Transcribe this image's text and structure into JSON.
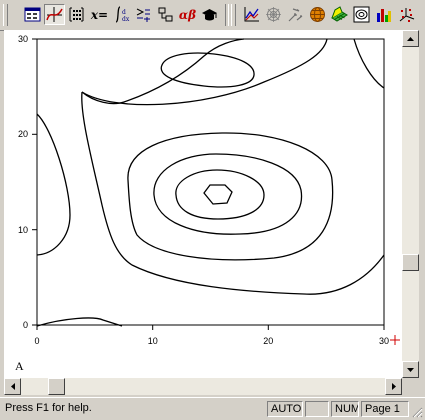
{
  "toolbar": {
    "buttons": [
      {
        "name": "calculator-window-icon",
        "pressed": false
      },
      {
        "name": "graph-2d-icon",
        "pressed": true
      },
      {
        "name": "matrix-icon",
        "pressed": false
      },
      {
        "name": "evaluate-button",
        "label": "x=",
        "pressed": false
      },
      {
        "name": "calculus-icon",
        "pressed": false
      },
      {
        "name": "boolean-icon",
        "pressed": false
      },
      {
        "name": "programming-icon",
        "pressed": false
      },
      {
        "name": "greek-button",
        "label": "αβ",
        "pressed": false
      },
      {
        "name": "symbolic-icon",
        "pressed": false
      },
      {
        "name": "xy-plot-icon",
        "pressed": false
      },
      {
        "name": "polar-plot-icon",
        "pressed": false
      },
      {
        "name": "vector-field-icon",
        "pressed": false
      },
      {
        "name": "globe-plot-icon",
        "pressed": false
      },
      {
        "name": "surface-plot-icon",
        "pressed": false
      },
      {
        "name": "contour-plot-icon",
        "pressed": false
      },
      {
        "name": "bar-plot-icon",
        "pressed": false
      },
      {
        "name": "scatter-3d-icon",
        "pressed": false
      }
    ]
  },
  "chart_data": {
    "type": "contour",
    "xlim": [
      0,
      30
    ],
    "ylim": [
      0,
      30
    ],
    "x_ticks": [
      "0",
      "10",
      "20",
      "30"
    ],
    "y_ticks": [
      "0",
      "10",
      "20",
      "30"
    ],
    "grid": false,
    "matrix_label": "A"
  },
  "status": {
    "help_text": "Press F1 for help.",
    "auto": "AUTO",
    "num": "NUM",
    "page": "Page 1"
  }
}
